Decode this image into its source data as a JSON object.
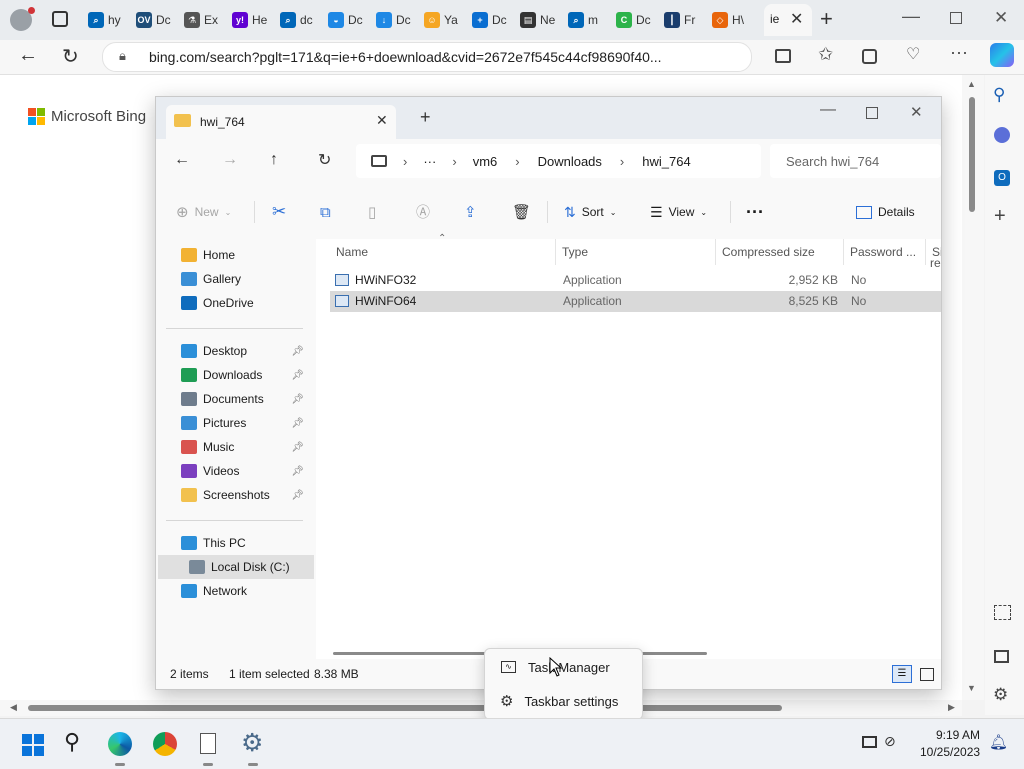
{
  "browser": {
    "tabs": [
      {
        "label": "hy",
        "icon": "search-icon",
        "color": "#0067b8",
        "glyph": "⌕"
      },
      {
        "label": "Dc",
        "icon": "ov-icon",
        "color": "#1f4e79",
        "glyph": "OV"
      },
      {
        "label": "Ex",
        "icon": "flask-icon",
        "color": "#555",
        "glyph": "⚗"
      },
      {
        "label": "He",
        "icon": "yahoo-icon",
        "color": "#6001d2",
        "glyph": "y!"
      },
      {
        "label": "dc",
        "icon": "search-icon",
        "color": "#0067b8",
        "glyph": "⌕"
      },
      {
        "label": "Dc",
        "icon": "edge-icon",
        "color": "#1e88e5",
        "glyph": "◒"
      },
      {
        "label": "Dc",
        "icon": "download-icon",
        "color": "#1e88e5",
        "glyph": "↓"
      },
      {
        "label": "Ya",
        "icon": "emoji-icon",
        "color": "#f5a623",
        "glyph": "☺"
      },
      {
        "label": "Dc",
        "icon": "plus-icon",
        "color": "#0a6ed1",
        "glyph": "+"
      },
      {
        "label": "Ne",
        "icon": "news-icon",
        "color": "#333",
        "glyph": "▤"
      },
      {
        "label": "m",
        "icon": "search-icon",
        "color": "#0067b8",
        "glyph": "⌕"
      },
      {
        "label": "Dc",
        "icon": "copilot-icon",
        "color": "#2cb34a",
        "glyph": "C"
      },
      {
        "label": "Fr",
        "icon": "chart-icon",
        "color": "#1a3d6d",
        "glyph": "┃"
      },
      {
        "label": "H\\",
        "icon": "diamond-icon",
        "color": "#e8650b",
        "glyph": "◇"
      }
    ],
    "active_tab_label": "ie",
    "url": "bing.com/search?pglt=171&q=ie+6+doewnload&cvid=2672e7f545c44cf98690f40...",
    "bing_logo": "Microsoft Bing"
  },
  "explorer": {
    "tab_title": "hwi_764",
    "breadcrumb": [
      "vm6",
      "Downloads",
      "hwi_764"
    ],
    "breadcrumb_more": "···",
    "search_placeholder": "Search hwi_764",
    "commands": {
      "new": "New",
      "sort": "Sort",
      "view": "View",
      "more": "···",
      "details": "Details"
    },
    "sidebar": {
      "top": [
        {
          "label": "Home",
          "color": "#f2b233"
        },
        {
          "label": "Gallery",
          "color": "#3a8fd6"
        },
        {
          "label": "OneDrive",
          "color": "#0f6cbd"
        }
      ],
      "pinned": [
        {
          "label": "Desktop",
          "color": "#2b8fd9"
        },
        {
          "label": "Downloads",
          "color": "#1f9d55"
        },
        {
          "label": "Documents",
          "color": "#6e7c8c"
        },
        {
          "label": "Pictures",
          "color": "#3a8fd6"
        },
        {
          "label": "Music",
          "color": "#d9534f"
        },
        {
          "label": "Videos",
          "color": "#7b3fbf"
        },
        {
          "label": "Screenshots",
          "color": "#f2c14e"
        }
      ],
      "pc": [
        {
          "label": "This PC",
          "color": "#2b8fd9"
        },
        {
          "label": "Local Disk (C:)",
          "color": "#7a8a99"
        },
        {
          "label": "Network",
          "color": "#2b8fd9"
        }
      ]
    },
    "columns": [
      "Name",
      "Type",
      "Compressed size",
      "Password ...",
      "Si"
    ],
    "columns_tail": "re",
    "files": [
      {
        "name": "HWiNFO32",
        "type": "Application",
        "size": "2,952 KB",
        "password": "No"
      },
      {
        "name": "HWiNFO64",
        "type": "Application",
        "size": "8,525 KB",
        "password": "No"
      }
    ],
    "status": {
      "items": "2 items",
      "selected": "1 item selected",
      "size": "8.38 MB"
    }
  },
  "context_menu": {
    "items": [
      "Task Manager",
      "Taskbar settings"
    ]
  },
  "taskbar": {
    "time": "9:19 AM",
    "date": "10/25/2023"
  }
}
